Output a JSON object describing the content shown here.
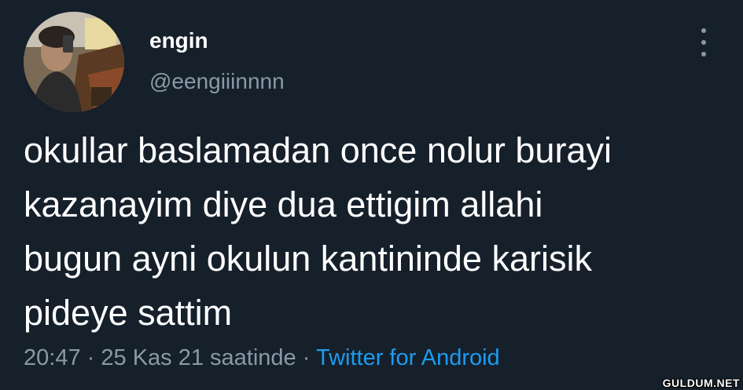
{
  "profile": {
    "display_name": "engin",
    "handle": "@eengiiinnnn",
    "avatar_icon": "profile-photo"
  },
  "menu": {
    "icon": "more-vertical-icon"
  },
  "tweet": {
    "lines": [
      "okullar baslamadan once nolur burayi",
      "kazanayim diye dua ettigim allahi",
      "bugun ayni okulun kantininde karisik",
      "pideye sattim"
    ]
  },
  "meta": {
    "time": "20:47",
    "separator": "·",
    "date": "25 Kas 21 saatinde",
    "source": "Twitter for Android"
  },
  "watermark": {
    "text": "GULDUM.NET"
  },
  "colors": {
    "background": "#15202b",
    "text": "#ffffff",
    "secondary": "#8b98a5",
    "link": "#1d9bf0"
  }
}
